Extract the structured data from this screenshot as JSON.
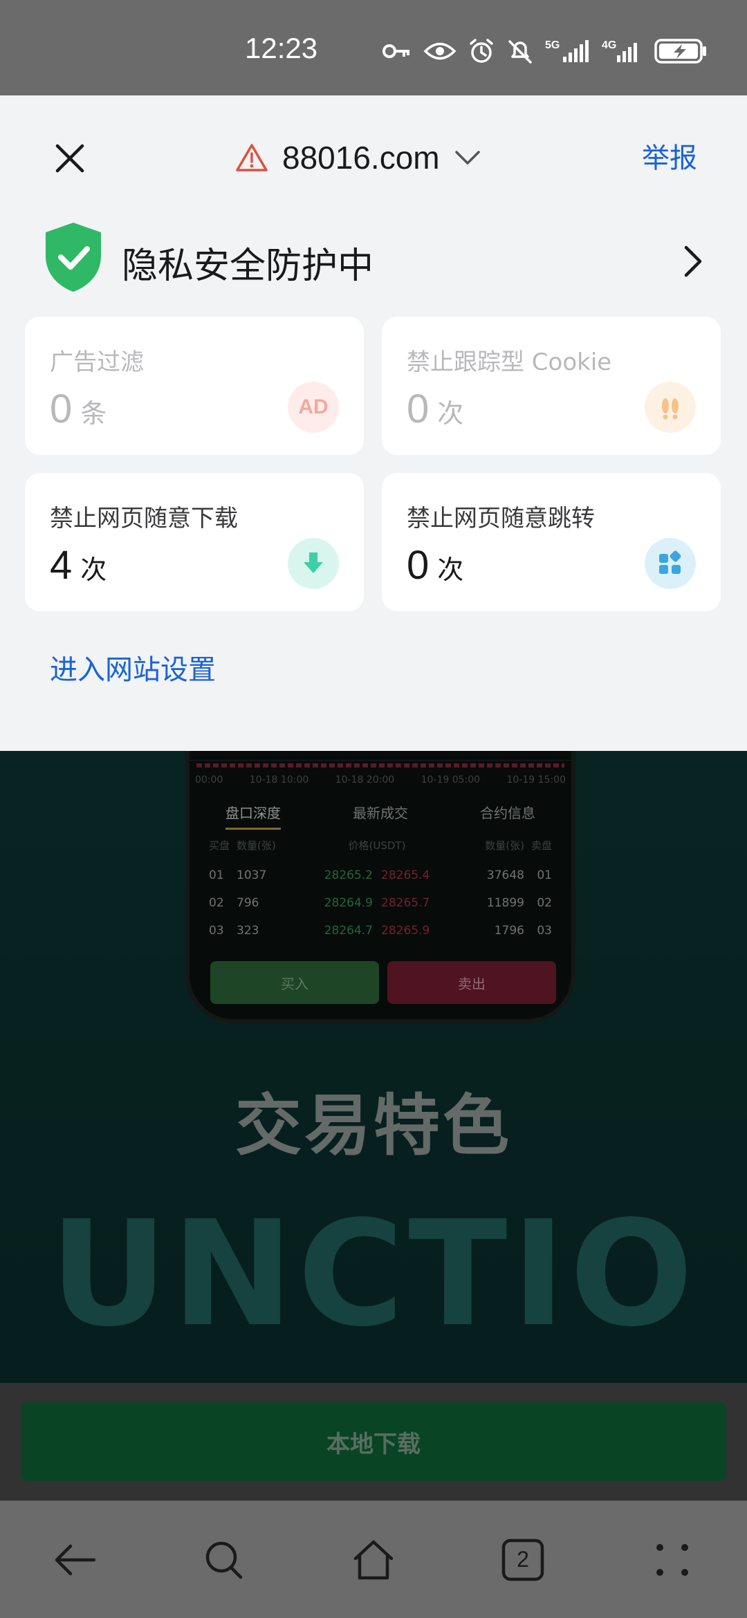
{
  "status_bar": {
    "time": "12:23",
    "icons": [
      "key-icon",
      "eye-icon",
      "alarm-icon",
      "mute-icon",
      "signal-5g-icon",
      "signal-4g-icon",
      "battery-charging-icon"
    ]
  },
  "sheet": {
    "site": {
      "domain": "88016.com",
      "warning_icon": "warning-triangle-icon"
    },
    "report_label": "举报",
    "privacy": {
      "title": "隐私安全防护中"
    },
    "cards": [
      {
        "id": "ad",
        "label": "广告过滤",
        "value": "0",
        "unit": "条",
        "badge": "AD",
        "badge_color": "#f3a8a0"
      },
      {
        "id": "cookie",
        "label": "禁止跟踪型 Cookie",
        "value": "0",
        "unit": "次",
        "badge_color": "#f5c28a"
      },
      {
        "id": "download",
        "label": "禁止网页随意下载",
        "value": "4",
        "unit": "次",
        "badge_color": "#3ecfa6"
      },
      {
        "id": "redirect",
        "label": "禁止网页随意跳转",
        "value": "0",
        "unit": "次",
        "badge_color": "#3aa6e0"
      }
    ],
    "site_settings_link": "进入网站设置"
  },
  "background_page": {
    "axis_labels": [
      "00:00",
      "10-18 10:00",
      "10-18 20:00",
      "10-19 05:00",
      "10-19 15:00"
    ],
    "tabs": [
      "盘口深度",
      "最新成交",
      "合约信息"
    ],
    "table_headers": [
      "买盘",
      "数量(张)",
      "价格(USDT)",
      "数量(张)",
      "卖盘"
    ],
    "rows": [
      {
        "left_idx": "01",
        "left_qty": "1037",
        "bid": "28265.2",
        "ask": "28265.4",
        "right_qty": "37648",
        "right_idx": "01"
      },
      {
        "left_idx": "02",
        "left_qty": "796",
        "bid": "28264.9",
        "ask": "28265.7",
        "right_qty": "11899",
        "right_idx": "02"
      },
      {
        "left_idx": "03",
        "left_qty": "323",
        "bid": "28264.7",
        "ask": "28265.9",
        "right_qty": "1796",
        "right_idx": "03"
      }
    ],
    "buy_label": "买入",
    "sell_label": "卖出",
    "features_title": "交易特色",
    "big_word": "UNCTIO",
    "download_button": "本地下载"
  },
  "nav_bar": {
    "tab_count": "2",
    "items": [
      "back-icon",
      "search-icon",
      "home-icon",
      "tabs-icon",
      "menu-icon"
    ]
  }
}
